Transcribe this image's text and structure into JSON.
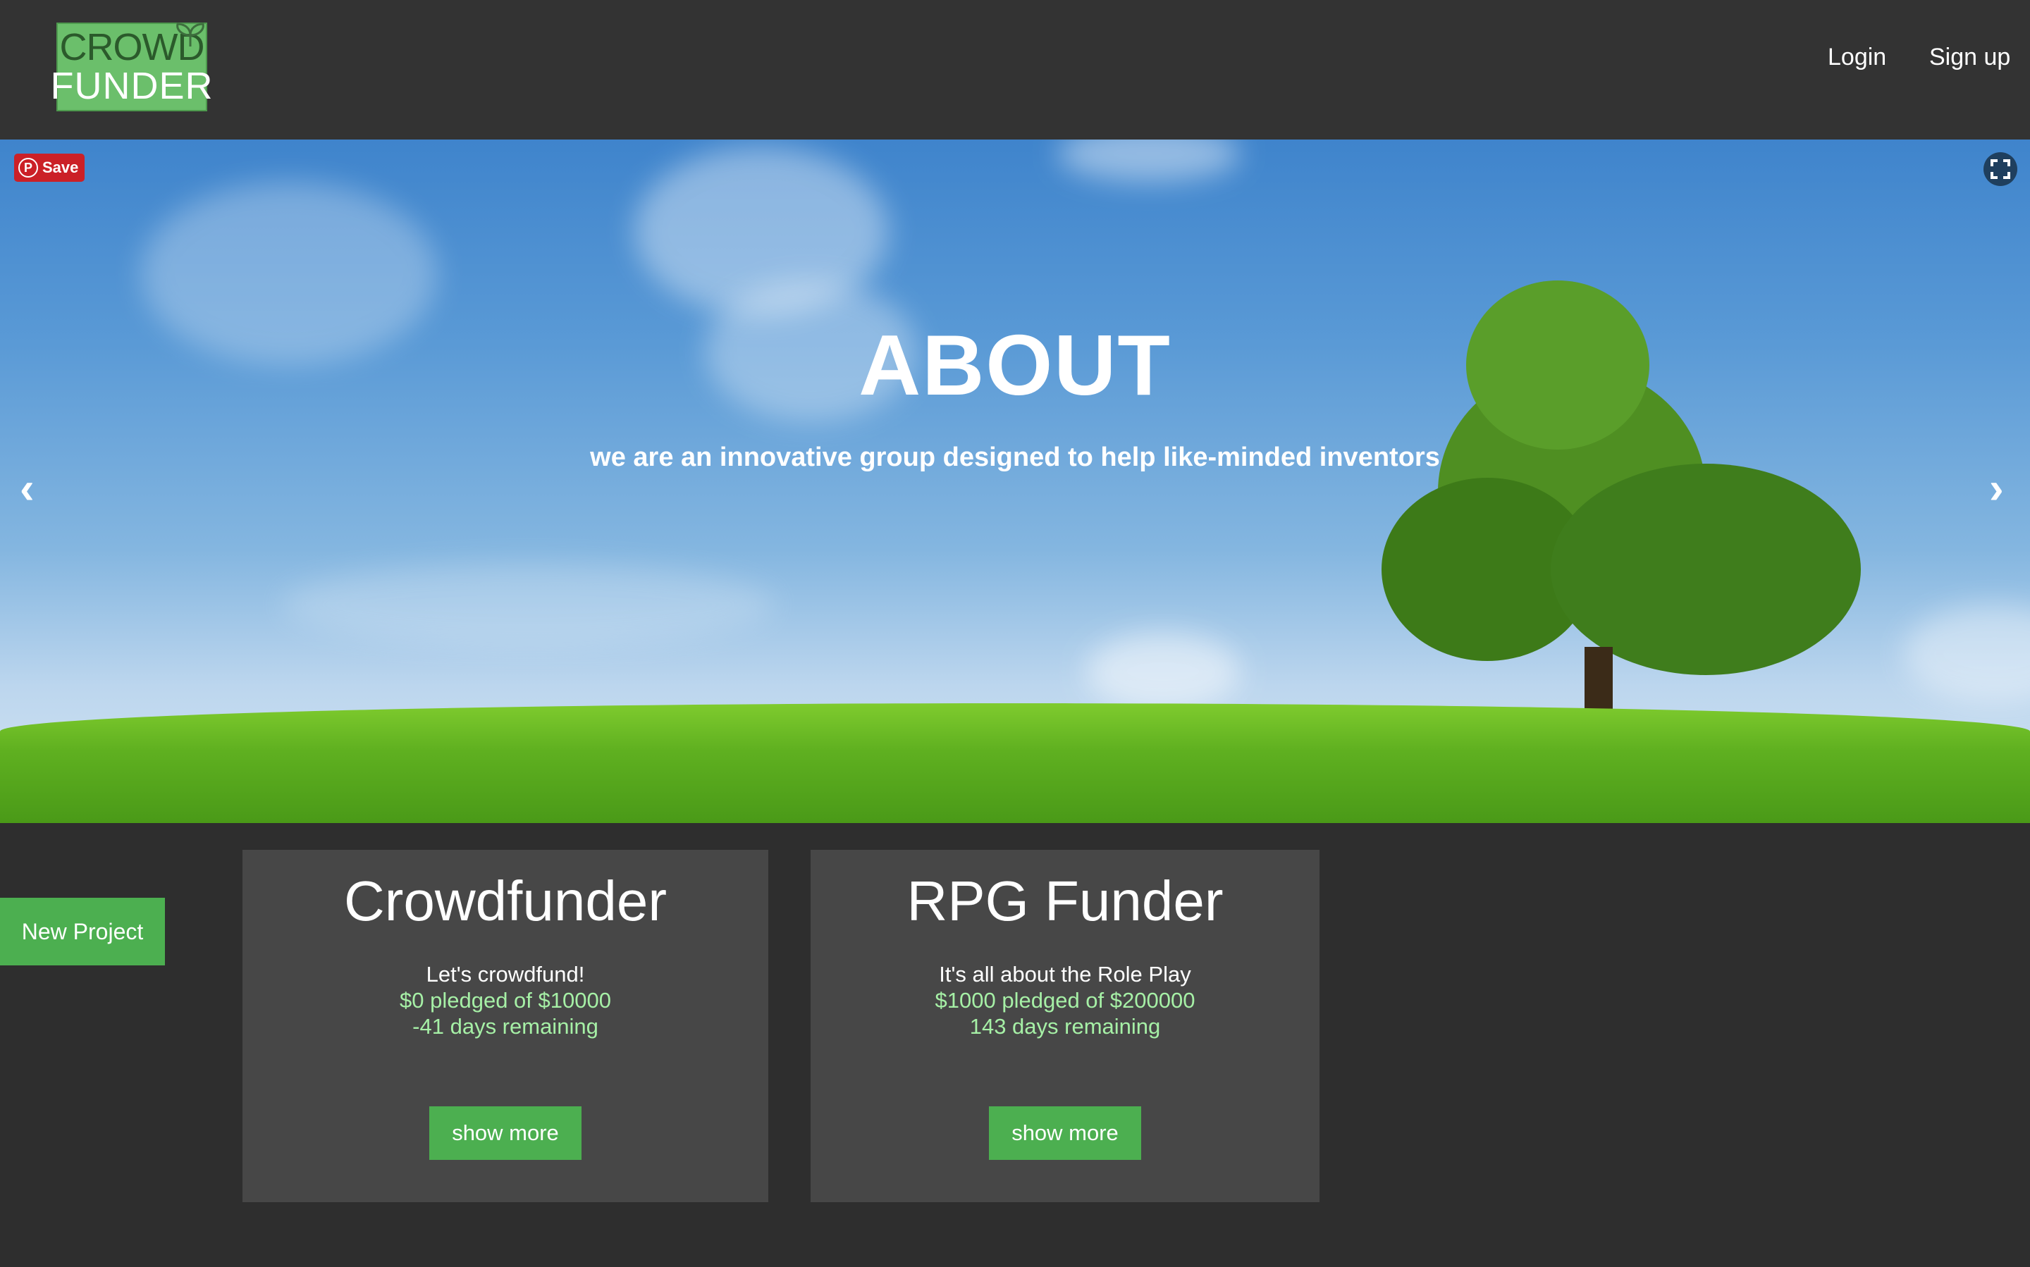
{
  "header": {
    "logo_line1": "CROWD",
    "logo_line2": "FUNDER",
    "nav": {
      "login": "Login",
      "signup": "Sign up"
    }
  },
  "hero": {
    "title": "ABOUT",
    "subtitle": "we are an innovative group designed to help like-minded inventors",
    "prev_arrow": "‹",
    "next_arrow": "›",
    "pinterest_label": "Save",
    "pinterest_icon": "pinterest-icon",
    "fullscreen_icon": "fullscreen-icon"
  },
  "actions": {
    "new_project": "New Project"
  },
  "projects": [
    {
      "title": "Crowdfunder",
      "description": "Let's crowdfund!",
      "pledged": "$0 pledged of $10000",
      "remaining": "-41 days remaining",
      "button": "show more"
    },
    {
      "title": "RPG Funder",
      "description": "It's all about the Role Play",
      "pledged": "$1000 pledged of $200000",
      "remaining": "143 days remaining",
      "button": "show more"
    }
  ],
  "colors": {
    "header_bg": "#333333",
    "page_bg": "#2e2e2e",
    "card_bg": "#474747",
    "accent_green": "#4caf50",
    "stat_green": "#a6f0a6",
    "pinterest_red": "#cb2027"
  }
}
